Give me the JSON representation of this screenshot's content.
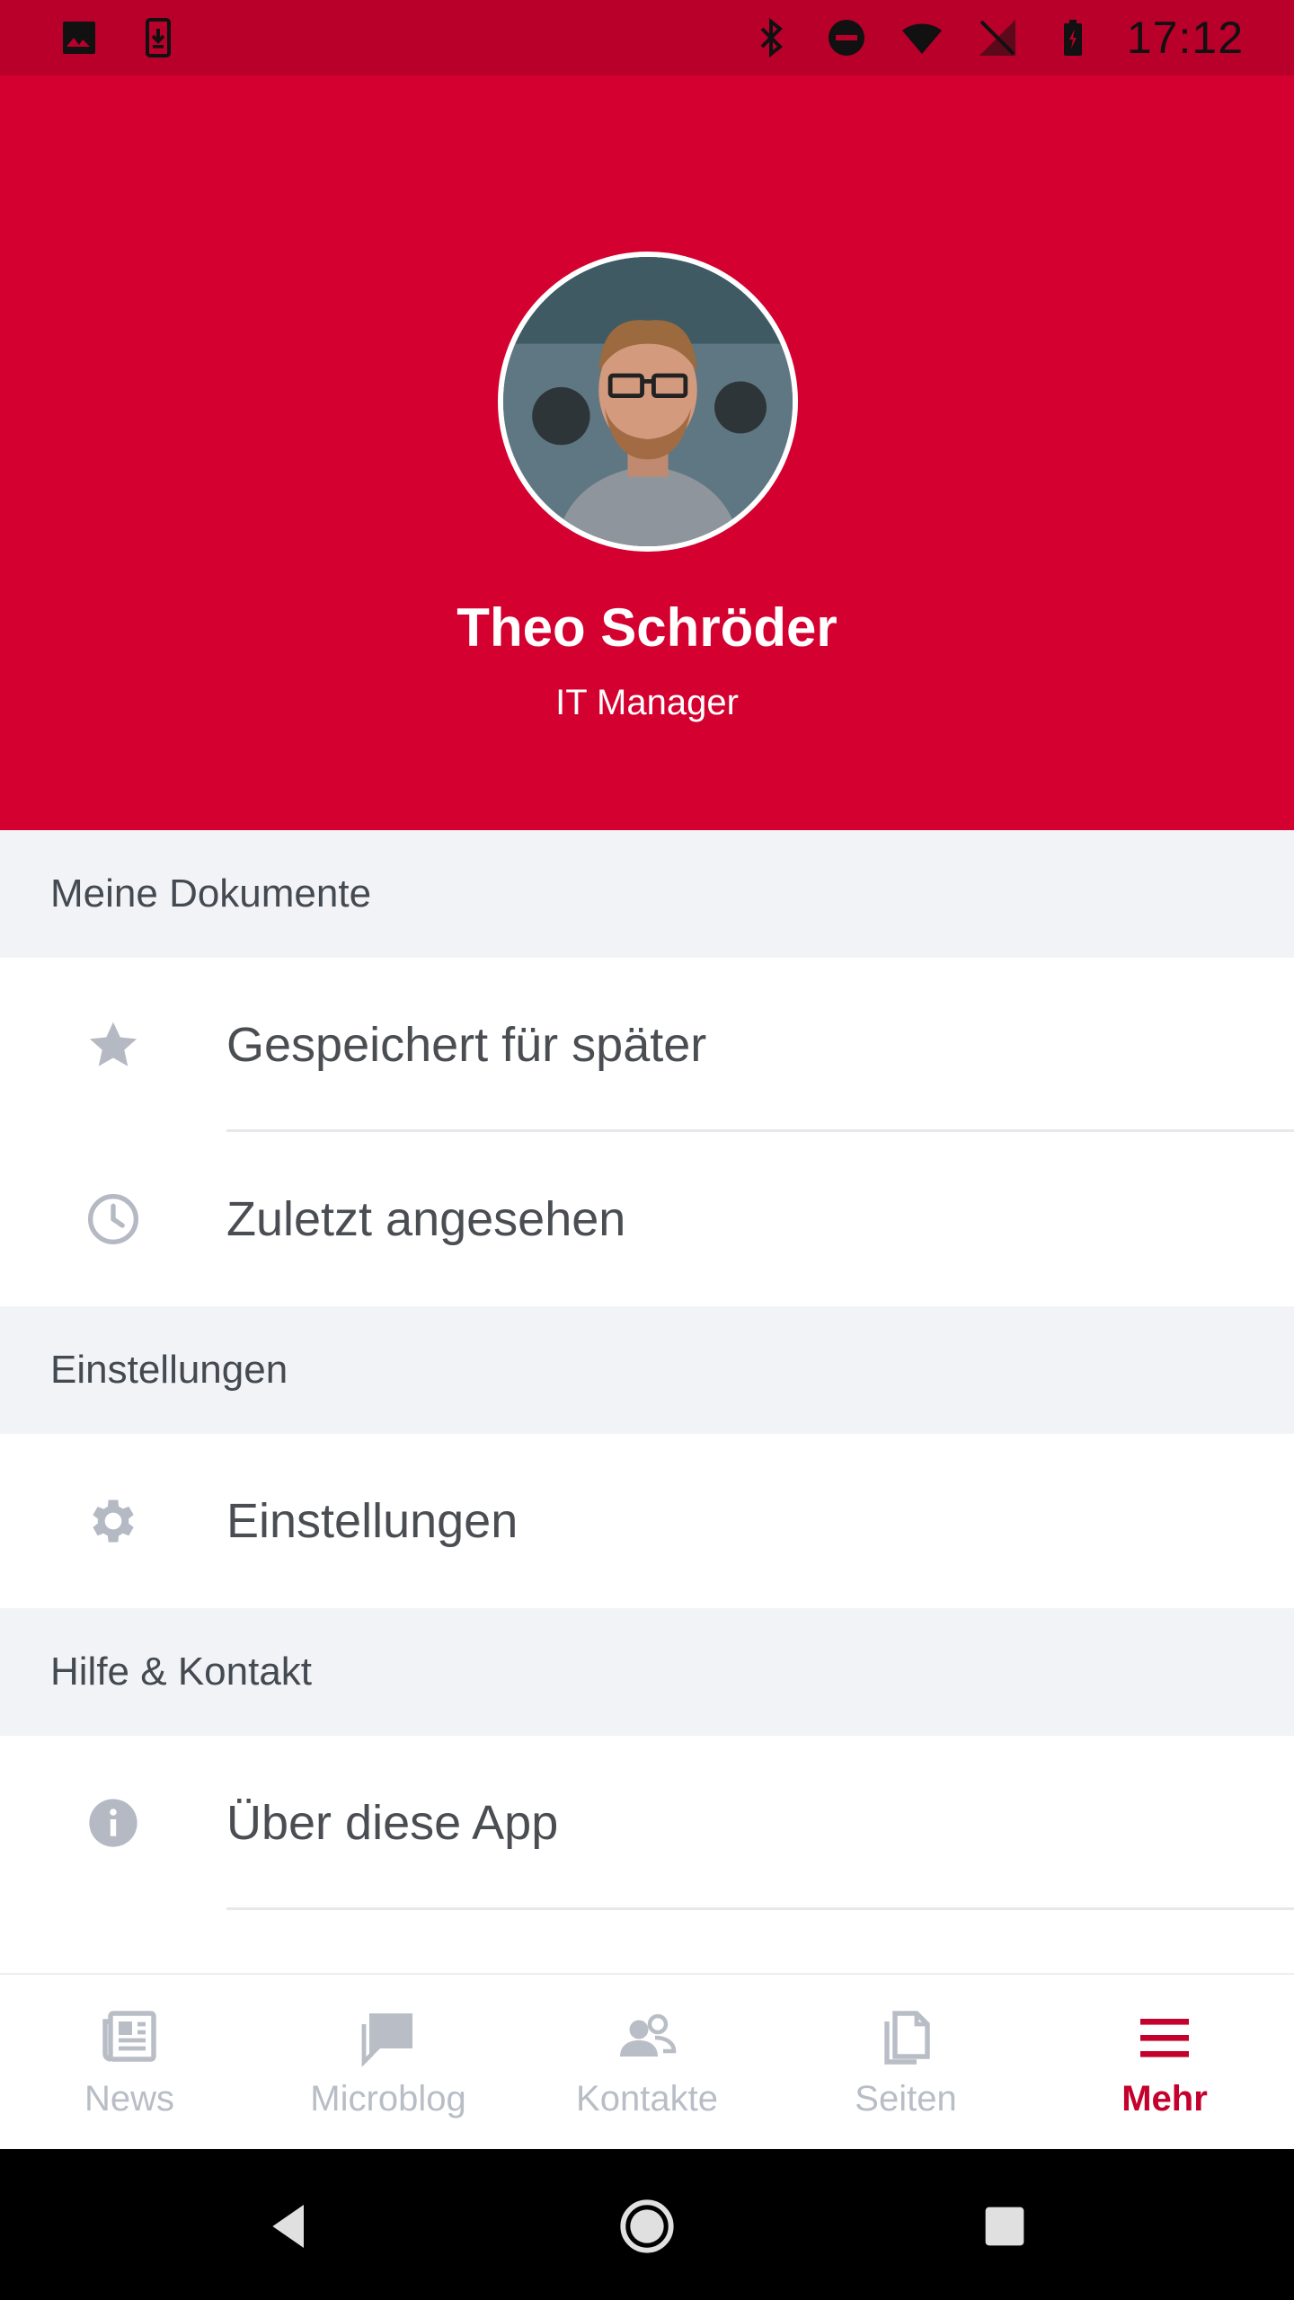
{
  "status_bar": {
    "time": "17:12",
    "left_icons": [
      "image-icon",
      "download-icon"
    ],
    "right_icons": [
      "bluetooth-icon",
      "do-not-disturb-icon",
      "wifi-icon",
      "no-sim-icon",
      "battery-charging-icon"
    ]
  },
  "profile": {
    "name": "Theo Schröder",
    "role": "IT Manager",
    "avatar_icon": "avatar-photo"
  },
  "sections": {
    "documents": {
      "title": "Meine Dokumente",
      "items": [
        {
          "label": "Gespeichert für später",
          "icon": "star-icon"
        },
        {
          "label": "Zuletzt angesehen",
          "icon": "clock-icon"
        }
      ]
    },
    "settings": {
      "title": "Einstellungen",
      "items": [
        {
          "label": "Einstellungen",
          "icon": "gear-icon"
        }
      ]
    },
    "help": {
      "title": "Hilfe & Kontakt",
      "items": [
        {
          "label": "Über diese App",
          "icon": "info-icon"
        }
      ]
    }
  },
  "bottom_nav": {
    "items": [
      {
        "label": "News",
        "icon": "newspaper-icon",
        "active": false
      },
      {
        "label": "Microblog",
        "icon": "chat-icon",
        "active": false
      },
      {
        "label": "Kontakte",
        "icon": "contacts-icon",
        "active": false
      },
      {
        "label": "Seiten",
        "icon": "pages-icon",
        "active": false
      },
      {
        "label": "Mehr",
        "icon": "menu-icon",
        "active": true
      }
    ]
  },
  "system_nav": [
    "back-icon",
    "home-icon",
    "recents-icon"
  ],
  "colors": {
    "brand_red": "#d40030",
    "status_bar": "#b8002a",
    "active_nav": "#c4002c",
    "inactive_nav": "#b8bdc6",
    "icon_gray": "#b4b9c3",
    "section_bg": "#f2f3f6"
  }
}
